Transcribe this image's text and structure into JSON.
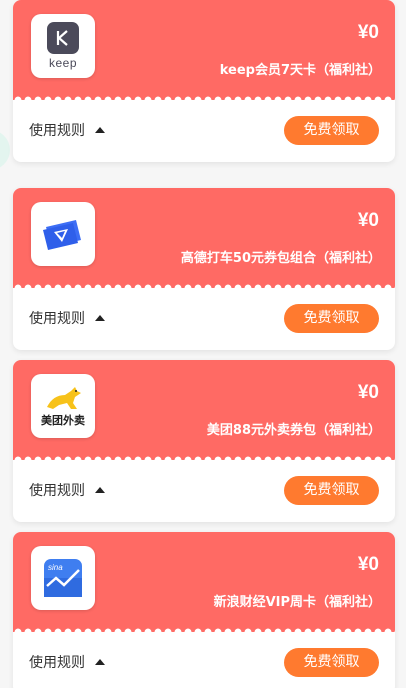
{
  "colors": {
    "card_header": "#ff6a64",
    "claim_button": "#ff7a2f",
    "page_background": "#f6f6f6"
  },
  "coupons": [
    {
      "logo": "keep-logo",
      "logo_text": "keep",
      "price": "¥0",
      "name": "keep会员7天卡（福利社）",
      "rules_label": "使用规则",
      "claim_label": "免费领取"
    },
    {
      "logo": "amap-ticket-logo",
      "price": "¥0",
      "name": "高德打车50元券包组合（福利社）",
      "rules_label": "使用规则",
      "claim_label": "免费领取"
    },
    {
      "logo": "meituan-waimai-logo",
      "logo_text": "美团外卖",
      "price": "¥0",
      "name": "美团88元外卖券包（福利社）",
      "rules_label": "使用规则",
      "claim_label": "免费领取"
    },
    {
      "logo": "sina-finance-logo",
      "logo_text": "sina",
      "price": "¥0",
      "name": "新浪财经VIP周卡（福利社）",
      "rules_label": "使用规则",
      "claim_label": "免费领取"
    }
  ]
}
